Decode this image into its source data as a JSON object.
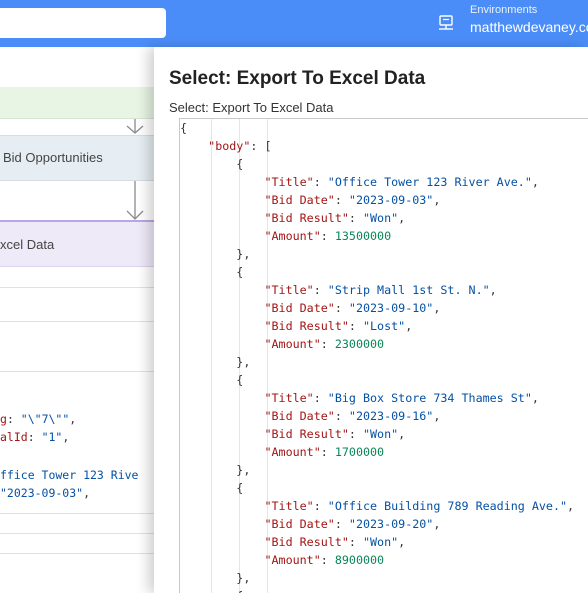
{
  "header": {
    "env_label": "Environments",
    "env_value": "matthewdevaney.com"
  },
  "canvas": {
    "card1_label": "Bid Opportunities",
    "card2_label": "xcel Data",
    "bg_lines": [
      {
        "key": "g",
        "sep": ": ",
        "val": "\"\\\"7\\\"\"",
        "tail": ","
      },
      {
        "key": "alId",
        "sep": ": ",
        "val": "\"1\"",
        "tail": ","
      },
      {
        "key": "",
        "sep": "",
        "val": "ffice Tower 123 Rive",
        "tail": ""
      },
      {
        "key": "",
        "sep": "",
        "val": "\"2023-09-03\"",
        "tail": ","
      }
    ]
  },
  "panel": {
    "title": "Select: Export To Excel Data",
    "subtitle": "Select: Export To Excel Data",
    "json_root_key": "body",
    "items": [
      {
        "Title": "Office Tower 123 River Ave.",
        "Bid Date": "2023-09-03",
        "Bid Result": "Won",
        "Amount": "13500000"
      },
      {
        "Title": "Strip Mall 1st St. N.",
        "Bid Date": "2023-09-10",
        "Bid Result": "Lost",
        "Amount": "2300000"
      },
      {
        "Title": "Big Box Store 734 Thames St",
        "Bid Date": "2023-09-16",
        "Bid Result": "Won",
        "Amount": "1700000"
      },
      {
        "Title": "Office Building 789 Reading Ave.",
        "Bid Date": "2023-09-20",
        "Bid Result": "Won",
        "Amount": "8900000"
      }
    ]
  },
  "colors": {
    "topbar": "#4b8df8",
    "json_key": "#a31515",
    "json_string": "#0451a5",
    "json_number": "#098658"
  }
}
